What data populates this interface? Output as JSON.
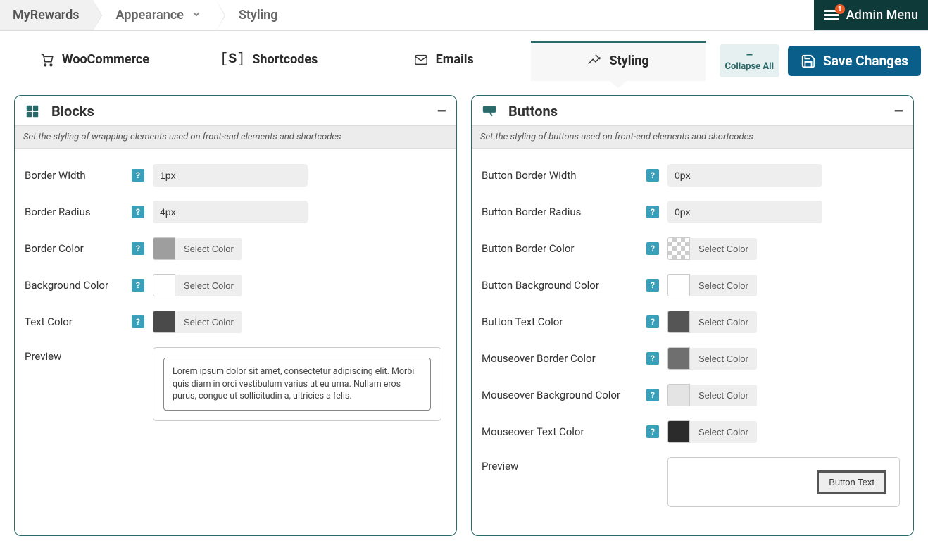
{
  "breadcrumb": {
    "root": "MyRewards",
    "parent": "Appearance",
    "current": "Styling"
  },
  "adminMenu": {
    "label": "Admin Menu",
    "badge": "1"
  },
  "tabs": {
    "woo": "WooCommerce",
    "shortcodes": "Shortcodes",
    "emails": "Emails",
    "styling": "Styling"
  },
  "actions": {
    "collapse": "Collapse All",
    "save": "Save Changes"
  },
  "blocks": {
    "title": "Blocks",
    "desc": "Set the styling of wrapping elements used on front-end elements and shortcodes",
    "borderWidth": {
      "label": "Border Width",
      "value": "1px"
    },
    "borderRadius": {
      "label": "Border Radius",
      "value": "4px"
    },
    "borderColor": {
      "label": "Border Color",
      "btn": "Select Color",
      "swatch": "#9e9e9e"
    },
    "bgColor": {
      "label": "Background Color",
      "btn": "Select Color",
      "swatch": "#ffffff"
    },
    "textColor": {
      "label": "Text Color",
      "btn": "Select Color",
      "swatch": "#4a4a4a"
    },
    "preview": {
      "label": "Preview",
      "text": "Lorem ipsum dolor sit amet, consectetur adipiscing elit. Morbi quis diam in orci vestibulum varius ut eu urna. Nullam eros purus, congue ut sollicitudin a, ultricies a felis."
    }
  },
  "buttons": {
    "title": "Buttons",
    "desc": "Set the styling of buttons used on front-end elements and shortcodes",
    "borderWidth": {
      "label": "Button Border Width",
      "value": "0px"
    },
    "borderRadius": {
      "label": "Button Border Radius",
      "value": "0px"
    },
    "borderColor": {
      "label": "Button Border Color",
      "btn": "Select Color"
    },
    "bgColor": {
      "label": "Button Background Color",
      "btn": "Select Color",
      "swatch": "#ffffff"
    },
    "textColor": {
      "label": "Button Text Color",
      "btn": "Select Color",
      "swatch": "#555555"
    },
    "hoverBorder": {
      "label": "Mouseover Border Color",
      "btn": "Select Color",
      "swatch": "#6f6f6f"
    },
    "hoverBg": {
      "label": "Mouseover Background Color",
      "btn": "Select Color",
      "swatch": "#e4e4e4"
    },
    "hoverText": {
      "label": "Mouseover Text Color",
      "btn": "Select Color",
      "swatch": "#2b2b2b"
    },
    "preview": {
      "label": "Preview",
      "buttonText": "Button Text"
    }
  },
  "helpGlyph": "?"
}
